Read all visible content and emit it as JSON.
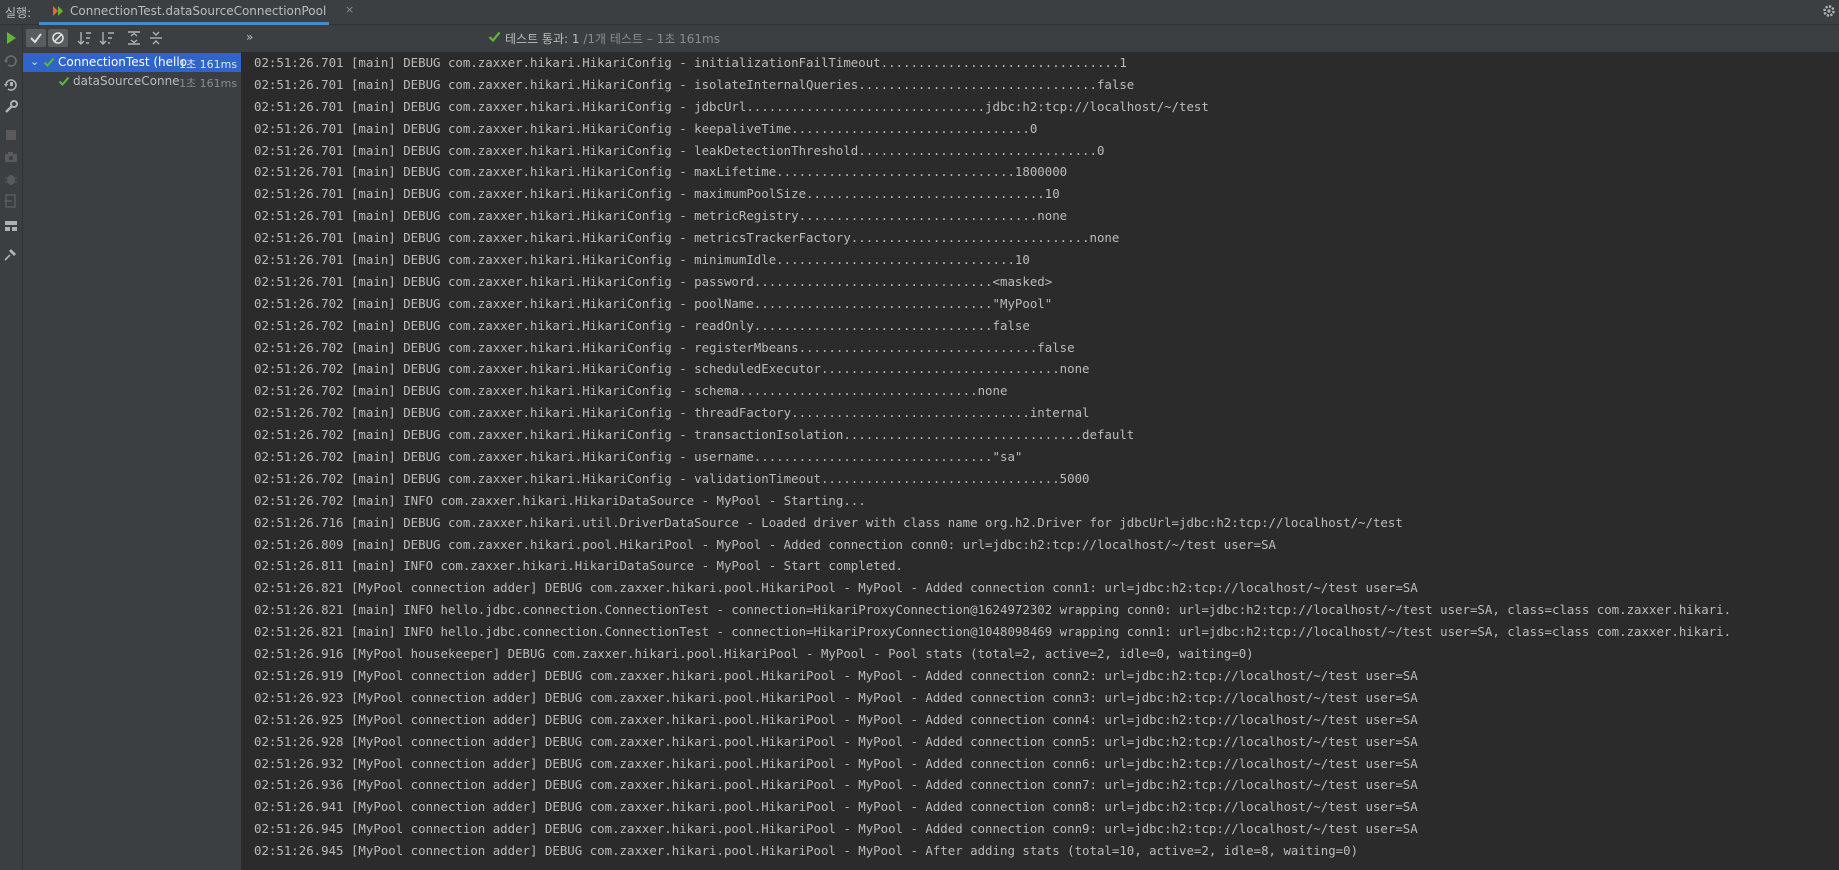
{
  "header": {
    "run_label": "실행:",
    "tab_label": "ConnectionTest.dataSourceConnectionPool",
    "tab_close": "×"
  },
  "icons": {
    "run_tab": "junit-run-icon",
    "settings": "gear-icon",
    "left_toolbar": [
      "rerun-icon",
      "rerun-failed-icon",
      "toggle-auto-test-icon",
      "wrench-icon",
      "stop-icon",
      "camera-icon",
      "debug-icon",
      "exit-icon",
      "layout-icon",
      "pin-icon"
    ],
    "tree_toolbar": [
      "show-passed-icon",
      "show-ignored-icon",
      "sort-alpha-icon",
      "sort-duration-icon",
      "expand-all-icon",
      "collapse-all-icon"
    ]
  },
  "tree": {
    "items": [
      {
        "label": "ConnectionTest (hello",
        "time": "1초 161ms",
        "selected": true,
        "level": 0
      },
      {
        "label": "dataSourceConne",
        "time": "1초 161ms",
        "selected": false,
        "level": 1
      }
    ]
  },
  "status": {
    "more": "»",
    "prefix": "테스트 통과: 1",
    "detail": " /1개 테스트 – 1초 161ms"
  },
  "colors": {
    "pass_green": "#5fb832",
    "accent_blue": "#4a88c7",
    "selection_blue": "#2f65ca",
    "console_bg": "#2b2b2b",
    "console_text": "#bbbbbb"
  },
  "console": {
    "lines": [
      "02:51:26.701 [main] DEBUG com.zaxxer.hikari.HikariConfig - initializationFailTimeout................................1",
      "02:51:26.701 [main] DEBUG com.zaxxer.hikari.HikariConfig - isolateInternalQueries................................false",
      "02:51:26.701 [main] DEBUG com.zaxxer.hikari.HikariConfig - jdbcUrl................................jdbc:h2:tcp://localhost/~/test",
      "02:51:26.701 [main] DEBUG com.zaxxer.hikari.HikariConfig - keepaliveTime................................0",
      "02:51:26.701 [main] DEBUG com.zaxxer.hikari.HikariConfig - leakDetectionThreshold................................0",
      "02:51:26.701 [main] DEBUG com.zaxxer.hikari.HikariConfig - maxLifetime................................1800000",
      "02:51:26.701 [main] DEBUG com.zaxxer.hikari.HikariConfig - maximumPoolSize................................10",
      "02:51:26.701 [main] DEBUG com.zaxxer.hikari.HikariConfig - metricRegistry................................none",
      "02:51:26.701 [main] DEBUG com.zaxxer.hikari.HikariConfig - metricsTrackerFactory................................none",
      "02:51:26.701 [main] DEBUG com.zaxxer.hikari.HikariConfig - minimumIdle................................10",
      "02:51:26.701 [main] DEBUG com.zaxxer.hikari.HikariConfig - password................................<masked>",
      "02:51:26.702 [main] DEBUG com.zaxxer.hikari.HikariConfig - poolName................................\"MyPool\"",
      "02:51:26.702 [main] DEBUG com.zaxxer.hikari.HikariConfig - readOnly................................false",
      "02:51:26.702 [main] DEBUG com.zaxxer.hikari.HikariConfig - registerMbeans................................false",
      "02:51:26.702 [main] DEBUG com.zaxxer.hikari.HikariConfig - scheduledExecutor................................none",
      "02:51:26.702 [main] DEBUG com.zaxxer.hikari.HikariConfig - schema................................none",
      "02:51:26.702 [main] DEBUG com.zaxxer.hikari.HikariConfig - threadFactory................................internal",
      "02:51:26.702 [main] DEBUG com.zaxxer.hikari.HikariConfig - transactionIsolation................................default",
      "02:51:26.702 [main] DEBUG com.zaxxer.hikari.HikariConfig - username................................\"sa\"",
      "02:51:26.702 [main] DEBUG com.zaxxer.hikari.HikariConfig - validationTimeout................................5000",
      "02:51:26.702 [main] INFO com.zaxxer.hikari.HikariDataSource - MyPool - Starting...",
      "02:51:26.716 [main] DEBUG com.zaxxer.hikari.util.DriverDataSource - Loaded driver with class name org.h2.Driver for jdbcUrl=jdbc:h2:tcp://localhost/~/test",
      "02:51:26.809 [main] DEBUG com.zaxxer.hikari.pool.HikariPool - MyPool - Added connection conn0: url=jdbc:h2:tcp://localhost/~/test user=SA",
      "02:51:26.811 [main] INFO com.zaxxer.hikari.HikariDataSource - MyPool - Start completed.",
      "02:51:26.821 [MyPool connection adder] DEBUG com.zaxxer.hikari.pool.HikariPool - MyPool - Added connection conn1: url=jdbc:h2:tcp://localhost/~/test user=SA",
      "02:51:26.821 [main] INFO hello.jdbc.connection.ConnectionTest - connection=HikariProxyConnection@1624972302 wrapping conn0: url=jdbc:h2:tcp://localhost/~/test user=SA, class=class com.zaxxer.hikari.",
      "02:51:26.821 [main] INFO hello.jdbc.connection.ConnectionTest - connection=HikariProxyConnection@1048098469 wrapping conn1: url=jdbc:h2:tcp://localhost/~/test user=SA, class=class com.zaxxer.hikari.",
      "02:51:26.916 [MyPool housekeeper] DEBUG com.zaxxer.hikari.pool.HikariPool - MyPool - Pool stats (total=2, active=2, idle=0, waiting=0)",
      "02:51:26.919 [MyPool connection adder] DEBUG com.zaxxer.hikari.pool.HikariPool - MyPool - Added connection conn2: url=jdbc:h2:tcp://localhost/~/test user=SA",
      "02:51:26.923 [MyPool connection adder] DEBUG com.zaxxer.hikari.pool.HikariPool - MyPool - Added connection conn3: url=jdbc:h2:tcp://localhost/~/test user=SA",
      "02:51:26.925 [MyPool connection adder] DEBUG com.zaxxer.hikari.pool.HikariPool - MyPool - Added connection conn4: url=jdbc:h2:tcp://localhost/~/test user=SA",
      "02:51:26.928 [MyPool connection adder] DEBUG com.zaxxer.hikari.pool.HikariPool - MyPool - Added connection conn5: url=jdbc:h2:tcp://localhost/~/test user=SA",
      "02:51:26.932 [MyPool connection adder] DEBUG com.zaxxer.hikari.pool.HikariPool - MyPool - Added connection conn6: url=jdbc:h2:tcp://localhost/~/test user=SA",
      "02:51:26.936 [MyPool connection adder] DEBUG com.zaxxer.hikari.pool.HikariPool - MyPool - Added connection conn7: url=jdbc:h2:tcp://localhost/~/test user=SA",
      "02:51:26.941 [MyPool connection adder] DEBUG com.zaxxer.hikari.pool.HikariPool - MyPool - Added connection conn8: url=jdbc:h2:tcp://localhost/~/test user=SA",
      "02:51:26.945 [MyPool connection adder] DEBUG com.zaxxer.hikari.pool.HikariPool - MyPool - Added connection conn9: url=jdbc:h2:tcp://localhost/~/test user=SA",
      "02:51:26.945 [MyPool connection adder] DEBUG com.zaxxer.hikari.pool.HikariPool - MyPool - After adding stats (total=10, active=2, idle=8, waiting=0)"
    ]
  }
}
